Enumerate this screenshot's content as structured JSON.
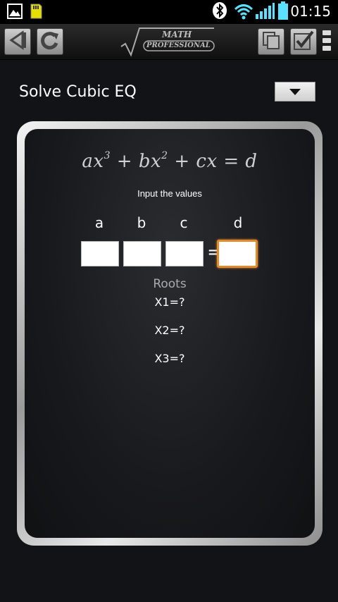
{
  "statusbar": {
    "time": "01:15",
    "icons": [
      "image-icon",
      "sd-card-icon",
      "bluetooth-icon",
      "wifi-icon",
      "signal-icon",
      "battery-icon"
    ]
  },
  "toolbar": {
    "back": "back-arrow-icon",
    "refresh": "refresh-icon",
    "logo_line1": "MATH",
    "logo_line2": "PROFESSIONAL",
    "copy": "copy-icon",
    "check": "checkmark-icon"
  },
  "page": {
    "title": "Solve Cubic EQ"
  },
  "board": {
    "equation": {
      "t1": "ax",
      "e1": "3",
      "t2": " + bx",
      "e2": "2",
      "t3": " + cx = d"
    },
    "instruction": "Input the values",
    "labels": {
      "a": "a",
      "b": "b",
      "c": "c",
      "d": "d"
    },
    "equals": "=",
    "inputs": {
      "a": "",
      "b": "",
      "c": "",
      "d": ""
    },
    "roots_label": "Roots",
    "roots": {
      "x1": "X1=?",
      "x2": "X2=?",
      "x3": "X3=?"
    }
  },
  "colors": {
    "accent_focus": "#e58a2b",
    "board": "#18191c",
    "frame": "#d6d6d6"
  }
}
